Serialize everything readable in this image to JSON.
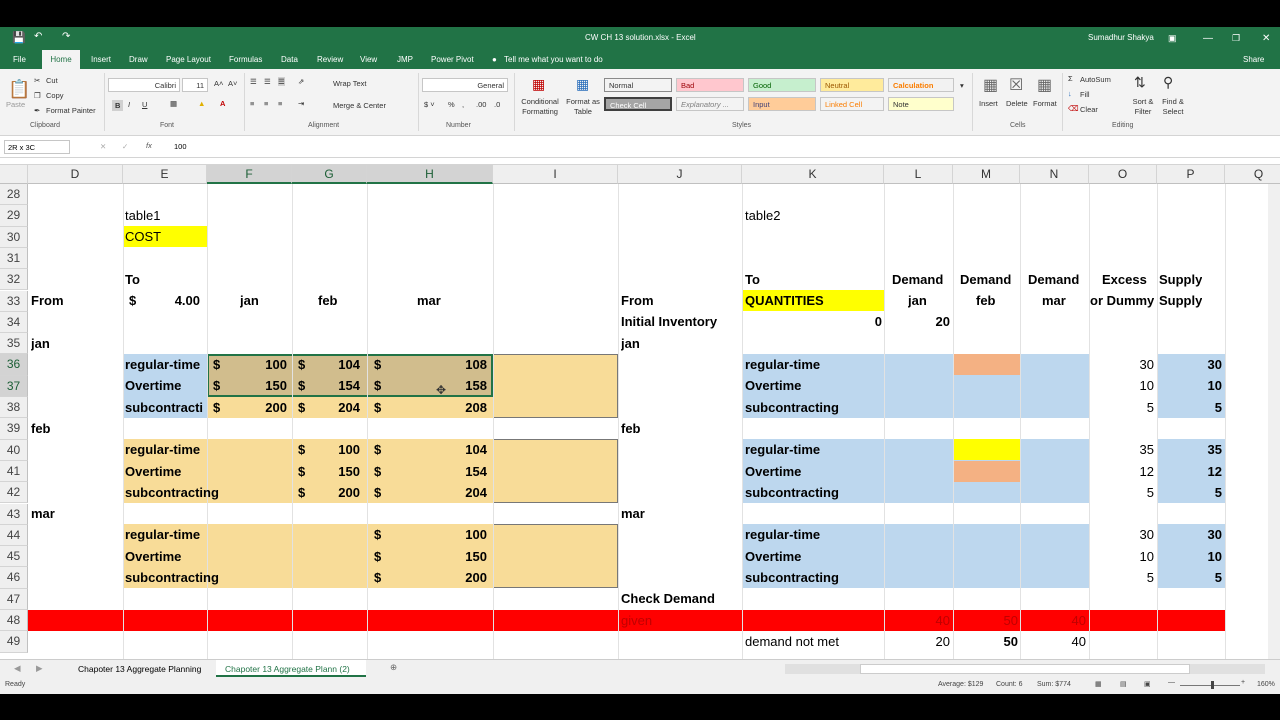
{
  "titlebar": {
    "filename": "CW CH 13 solution.xlsx - Excel",
    "user": "Sumadhur Shakya"
  },
  "ribbon_tabs": [
    "File",
    "Home",
    "Insert",
    "Draw",
    "Page Layout",
    "Formulas",
    "Data",
    "Review",
    "View",
    "JMP",
    "Power Pivot"
  ],
  "tell_me": "Tell me what you want to do",
  "share": "Share",
  "ribbon": {
    "clipboard": {
      "paste": "Paste",
      "cut": "Cut",
      "copy": "Copy",
      "format_painter": "Format Painter",
      "label": "Clipboard"
    },
    "font": {
      "name": "Calibri",
      "size": "11",
      "label": "Font"
    },
    "alignment": {
      "wrap": "Wrap Text",
      "merge": "Merge & Center",
      "label": "Alignment"
    },
    "number": {
      "format": "General",
      "label": "Number"
    },
    "styles": {
      "conditional": "Conditional Formatting",
      "format_as_table": "Format as Table",
      "label": "Styles",
      "cells": [
        {
          "text": "Normal",
          "bg": "#ffffff",
          "fg": "#000000"
        },
        {
          "text": "Bad",
          "bg": "#ffc7ce",
          "fg": "#9c0006"
        },
        {
          "text": "Good",
          "bg": "#c6efce",
          "fg": "#006100"
        },
        {
          "text": "Neutral",
          "bg": "#ffeb9c",
          "fg": "#9c5700"
        },
        {
          "text": "Calculation",
          "bg": "#f2f2f2",
          "fg": "#fa7d00"
        },
        {
          "text": "Check Cell",
          "bg": "#a5a5a5",
          "fg": "#ffffff"
        },
        {
          "text": "Explanatory ...",
          "bg": "#ffffff",
          "fg": "#7f7f7f"
        },
        {
          "text": "Input",
          "bg": "#ffcc99",
          "fg": "#3f3f76"
        },
        {
          "text": "Linked Cell",
          "bg": "#ffffff",
          "fg": "#fa7d00"
        },
        {
          "text": "Note",
          "bg": "#ffffcc",
          "fg": "#000000"
        }
      ]
    },
    "cells_grp": {
      "insert": "Insert",
      "delete": "Delete",
      "format": "Format",
      "label": "Cells"
    },
    "editing": {
      "autosum": "AutoSum",
      "fill": "Fill",
      "clear": "Clear",
      "sort": "Sort & Filter",
      "find": "Find & Select",
      "label": "Editing"
    }
  },
  "formula_bar": {
    "name_box": "2R x 3C",
    "formula": "100"
  },
  "columns": [
    "D",
    "E",
    "F",
    "G",
    "H",
    "I",
    "J",
    "K",
    "L",
    "M",
    "N",
    "O",
    "P",
    "Q"
  ],
  "rows": [
    "28",
    "29",
    "30",
    "31",
    "32",
    "33",
    "34",
    "35",
    "36",
    "37",
    "38",
    "39",
    "40",
    "41",
    "42",
    "43",
    "44",
    "45",
    "46",
    "47",
    "48",
    "49"
  ],
  "sheet": {
    "table1": "table1",
    "cost": "COST",
    "to": "To",
    "from": "From",
    "dollar": "$",
    "rate": "4.00",
    "jan": "jan",
    "feb": "feb",
    "mar": "mar",
    "regular": "regular-time",
    "overtime": "Overtime",
    "subcontracting": "subcontracting",
    "subcontracting_cut": "subcontracti",
    "v36": [
      "100",
      "104",
      "108"
    ],
    "v37": [
      "150",
      "154",
      "158"
    ],
    "v38": [
      "200",
      "204",
      "208"
    ],
    "v40": [
      "100",
      "104"
    ],
    "v41": [
      "150",
      "154"
    ],
    "v42": [
      "200",
      "204"
    ],
    "v44": "100",
    "v45": "150",
    "v46": "200",
    "table2": "table2",
    "quantities": "QUANTITIES",
    "initial_inventory": "Initial Inventory",
    "demand": "Demand",
    "excess": "Excess",
    "or_dummy": "or Dummy",
    "supply": "Supply",
    "inv_l": "0",
    "inv_m": "20",
    "o36": "30",
    "p36": "30",
    "o37": "10",
    "p37": "10",
    "o38": "5",
    "p38": "5",
    "o40": "35",
    "p40": "35",
    "o41": "12",
    "p41": "12",
    "o42": "5",
    "p42": "5",
    "o44": "30",
    "p44": "30",
    "o45": "10",
    "p45": "10",
    "o46": "5",
    "p46": "5",
    "check_demand": "Check Demand",
    "given": "given",
    "g_l": "40",
    "g_m": "50",
    "g_n": "40",
    "demand_not_met": "demand not met",
    "d_l": "20",
    "d_m": "50",
    "d_n": "40"
  },
  "sheet_tabs": [
    "Chapoter 13 Aggregate Planning",
    "Chapoter 13 Aggregate Plann (2)"
  ],
  "status": {
    "ready": "Ready",
    "average": "Average: $129",
    "count": "Count: 6",
    "sum": "Sum: $774",
    "zoom": "160%"
  }
}
